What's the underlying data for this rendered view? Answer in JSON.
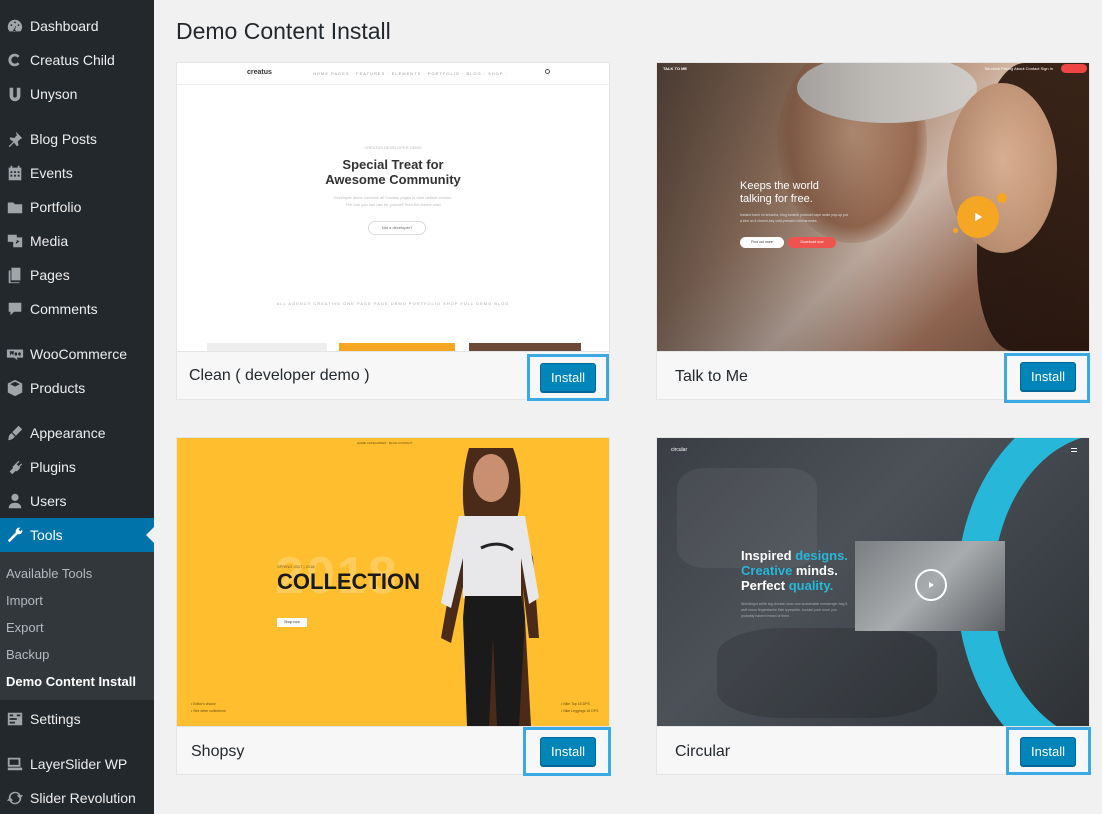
{
  "sidebar": {
    "items": [
      {
        "id": "dashboard",
        "label": "Dashboard",
        "icon": "dashboard-icon"
      },
      {
        "id": "creatus-child",
        "label": "Creatus Child",
        "icon": "creatus-icon"
      },
      {
        "id": "unyson",
        "label": "Unyson",
        "icon": "unyson-icon"
      },
      {
        "id": "blog-posts",
        "label": "Blog Posts",
        "icon": "pin-icon"
      },
      {
        "id": "events",
        "label": "Events",
        "icon": "calendar-icon"
      },
      {
        "id": "portfolio",
        "label": "Portfolio",
        "icon": "folder-icon"
      },
      {
        "id": "media",
        "label": "Media",
        "icon": "media-icon"
      },
      {
        "id": "pages",
        "label": "Pages",
        "icon": "pages-icon"
      },
      {
        "id": "comments",
        "label": "Comments",
        "icon": "comment-icon"
      },
      {
        "id": "woocommerce",
        "label": "WooCommerce",
        "icon": "woocommerce-icon"
      },
      {
        "id": "products",
        "label": "Products",
        "icon": "box-icon"
      },
      {
        "id": "appearance",
        "label": "Appearance",
        "icon": "brush-icon"
      },
      {
        "id": "plugins",
        "label": "Plugins",
        "icon": "plug-icon"
      },
      {
        "id": "users",
        "label": "Users",
        "icon": "user-icon"
      },
      {
        "id": "tools",
        "label": "Tools",
        "icon": "wrench-icon"
      },
      {
        "id": "settings",
        "label": "Settings",
        "icon": "settings-icon"
      },
      {
        "id": "layerslider",
        "label": "LayerSlider WP",
        "icon": "layers-icon"
      },
      {
        "id": "slider-revolution",
        "label": "Slider Revolution",
        "icon": "refresh-icon"
      }
    ],
    "tools_submenu": [
      "Available Tools",
      "Import",
      "Export",
      "Backup",
      "Demo Content Install"
    ]
  },
  "page": {
    "title": "Demo Content Install"
  },
  "demos": [
    {
      "name": "Clean ( developer demo )",
      "install_label": "Install"
    },
    {
      "name": "Talk to Me",
      "install_label": "Install"
    },
    {
      "name": "Shopsy",
      "install_label": "Install"
    },
    {
      "name": "Circular",
      "install_label": "Install"
    }
  ],
  "thumbs": {
    "clean": {
      "brand": "creatus",
      "nav": "HOME   PAGES ·   FEATURES ·   ELEMENTS ·   PORTFOLIO ·   BLOG ·   SHOP ·",
      "kicker": "CREATUS DEVELOPER DEMO",
      "headline_1": "Special Treat for",
      "headline_2": "Awesome Community",
      "desc_1": "Developer demo contains all Creatus pages in their default version.",
      "desc_2": "The one you can use for yourself from the theme start",
      "button": "Not a developer?",
      "filters": "ALL   AGENCY   CREATIVE   ONE PAGE   PAGE DEMO   PORTFOLIO   SHOP   FULL DEMO   BLOG"
    },
    "talk": {
      "logo": "TALK TO ME",
      "nav": "Services     Pricing     About     Contact     Sign In",
      "headline_1": "Keeps the world",
      "headline_2": "talking for free.",
      "desc": "Iceland banh mi sriracha, blog tumeric polaroid vape woke pop-up put a bird on it church-key cold-pressed chicharrones.",
      "btn1": "Find out more",
      "btn2": "Download now"
    },
    "shopsy": {
      "year": "2018",
      "season": "SPRING 2017 | 2018",
      "collection": "COLLECTION",
      "shop": "Shop now",
      "nav": "HOME     CATEGORIES     ·     BLOG     CONTACT",
      "note_left_1": "• Editor's choice",
      "note_left_2": "• See other collections",
      "note_right_1": "• Nike Top 15 DPS",
      "note_right_2": "• Nike Leggings 16 DPS"
    },
    "circular": {
      "logo": "circul⁠ar",
      "h1_a": "Inspired ",
      "h1_b": "designs.",
      "h2_a": "Creative",
      "h2_b": " minds.",
      "h3_a": "Perfect ",
      "h3_b": "quality.",
      "desc": "Worldbigot selfie tag chicken slow cow sustainable messenger bag 8 wolf moon fingerstache fixie typewriter. tousled pork more you probably haven't heard of them."
    }
  }
}
